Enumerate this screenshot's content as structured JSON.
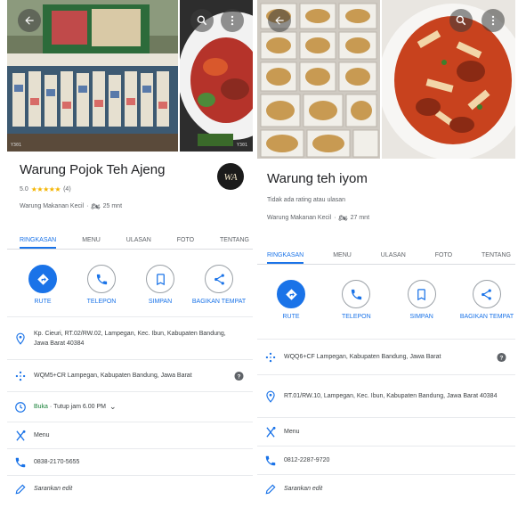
{
  "left": {
    "title": "Warung Pojok Teh Ajeng",
    "rating_value": "5.0",
    "stars": "★★★★★",
    "review_count": "(4)",
    "category": "Warung Makanan Kecil",
    "drive_time": "25 mnt",
    "photo_captions": [
      "Y301",
      "Y301"
    ],
    "tabs": [
      "RINGKASAN",
      "MENU",
      "ULASAN",
      "FOTO",
      "TENTANG"
    ],
    "actions": [
      "RUTE",
      "TELEPON",
      "SIMPAN",
      "BAGIKAN TEMPAT"
    ],
    "address": "Kp. Cieuri, RT.02/RW.02, Lampegan, Kec. Ibun, Kabupaten Bandung, Jawa Barat 40384",
    "plus_code": "WQM5+CR Lampegan, Kabupaten Bandung, Jawa Barat",
    "hours_status": "Buka",
    "hours_detail": "Tutup jam 6.00 PM",
    "menu_label": "Menu",
    "phone": "0838-2170-5655",
    "suggest_edit": "Sarankan edit",
    "logo_text": "WA"
  },
  "right": {
    "title": "Warung teh iyom",
    "no_rating": "Tidak ada rating atau ulasan",
    "category": "Warung Makanan Kecil",
    "drive_time": "27 mnt",
    "tabs": [
      "RINGKASAN",
      "MENU",
      "ULASAN",
      "FOTO",
      "TENTANG"
    ],
    "actions": [
      "RUTE",
      "TELEPON",
      "SIMPAN",
      "BAGIKAN TEMPAT"
    ],
    "plus_code": "WQQ6+CF Lampegan, Kabupaten Bandung, Jawa Barat",
    "address": "RT.01/RW.10, Lampegan, Kec. Ibun, Kabupaten Bandung, Jawa Barat 40384",
    "menu_label": "Menu",
    "phone": "0812-2287-9720",
    "suggest_edit": "Sarankan edit"
  },
  "colors": {
    "accent": "#1a73e8",
    "star": "#f4b400",
    "text_primary": "#202124",
    "text_secondary": "#5f6368"
  },
  "icons": [
    "back-arrow-icon",
    "search-icon",
    "more-vert-icon",
    "directions-icon",
    "phone-icon",
    "bookmark-icon",
    "share-icon",
    "location-pin-icon",
    "plus-code-icon",
    "clock-icon",
    "cutlery-icon",
    "pencil-icon",
    "help-icon",
    "motorcycle-icon"
  ]
}
